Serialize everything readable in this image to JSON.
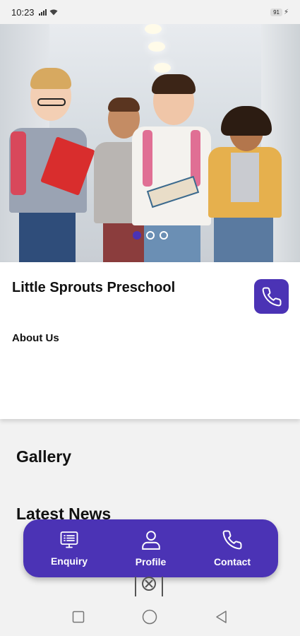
{
  "status_bar": {
    "time": "10:23",
    "battery": "91"
  },
  "hero": {
    "slides_total": 3,
    "active_slide": 1
  },
  "info": {
    "school_name": "Little Sprouts Preschool",
    "about_label": "About Us"
  },
  "sections": {
    "gallery": "Gallery",
    "latest_news": "Latest News"
  },
  "bottom_nav": {
    "items": [
      {
        "label": "Enquiry",
        "icon": "enquiry-icon"
      },
      {
        "label": "Profile",
        "icon": "profile-icon"
      },
      {
        "label": "Contact",
        "icon": "phone-icon"
      }
    ]
  },
  "colors": {
    "accent": "#4b33b5",
    "background": "#f2f2f2"
  }
}
